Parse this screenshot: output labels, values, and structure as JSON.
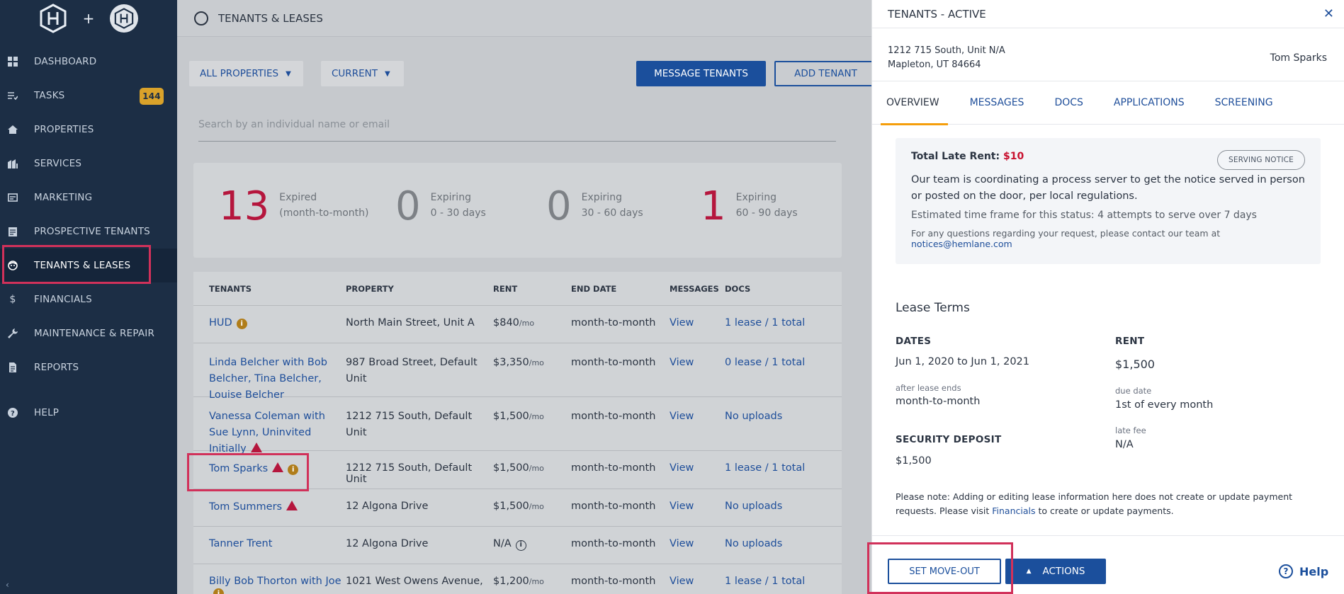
{
  "sidebar": {
    "logo_plus": "+",
    "items": [
      {
        "label": "DASHBOARD",
        "icon": "dashboard-icon"
      },
      {
        "label": "TASKS",
        "icon": "tasks-icon",
        "badge": "144"
      },
      {
        "label": "PROPERTIES",
        "icon": "home-icon"
      },
      {
        "label": "SERVICES",
        "icon": "services-icon"
      },
      {
        "label": "MARKETING",
        "icon": "marketing-icon"
      },
      {
        "label": "PROSPECTIVE TENANTS",
        "icon": "clipboard-icon"
      },
      {
        "label": "TENANTS & LEASES",
        "icon": "tenant-icon",
        "active": true
      },
      {
        "label": "FINANCIALS",
        "icon": "dollar-icon"
      },
      {
        "label": "MAINTENANCE & REPAIR",
        "icon": "wrench-icon"
      },
      {
        "label": "REPORTS",
        "icon": "report-icon"
      },
      {
        "label": "HELP",
        "icon": "help-icon"
      }
    ],
    "collapse_icon": "chevron-left-icon"
  },
  "main": {
    "title": "TENANTS & LEASES",
    "filters": {
      "properties": "ALL PROPERTIES",
      "status": "CURRENT"
    },
    "message_button": "MESSAGE TENANTS",
    "add_button": "ADD TENANT",
    "search_placeholder": "Search by an individual name or email",
    "stats": [
      {
        "num": "13",
        "line1": "Expired",
        "line2": "(month-to-month)"
      },
      {
        "num": "0",
        "line1": "Expiring",
        "line2": "0 - 30 days"
      },
      {
        "num": "0",
        "line1": "Expiring",
        "line2": "30 - 60 days"
      },
      {
        "num": "1",
        "line1": "Expiring",
        "line2": "60 - 90 days"
      }
    ],
    "table": {
      "headers": [
        "TENANTS",
        "PROPERTY",
        "RENT",
        "END DATE",
        "MESSAGES",
        "DOCS"
      ],
      "rows": [
        {
          "tenant": "HUD",
          "property": "North Main Street, Unit A",
          "rent": "$840",
          "per": "/mo",
          "end": "month-to-month",
          "messages": "View",
          "docs": "1 lease / 1 total"
        },
        {
          "tenant": "Linda Belcher with Bob Belcher, Tina Belcher, Louise Belcher",
          "property": "987 Broad Street, Default Unit",
          "rent": "$3,350",
          "per": "/mo",
          "end": "month-to-month",
          "messages": "View",
          "docs": "0 lease / 1 total"
        },
        {
          "tenant": "Vanessa Coleman with Sue Lynn, Uninvited Initially",
          "property": "1212 715 South, Default Unit",
          "rent": "$1,500",
          "per": "/mo",
          "end": "month-to-month",
          "messages": "View",
          "docs": "No uploads"
        },
        {
          "tenant": "Tom Sparks",
          "property": "1212 715 South, Default Unit",
          "rent": "$1,500",
          "per": "/mo",
          "end": "month-to-month",
          "messages": "View",
          "docs": "1 lease / 1 total"
        },
        {
          "tenant": "Tom Summers",
          "property": "12 Algona Drive",
          "rent": "$1,500",
          "per": "/mo",
          "end": "month-to-month",
          "messages": "View",
          "docs": "No uploads"
        },
        {
          "tenant": "Tanner Trent",
          "property": "12 Algona Drive",
          "rent": "N/A",
          "per": "",
          "end": "month-to-month",
          "messages": "View",
          "docs": "No uploads"
        },
        {
          "tenant": "Billy Bob Thorton with Joe",
          "property": "1021 West Owens Avenue,",
          "rent": "$1,200",
          "per": "/mo",
          "end": "month-to-month",
          "messages": "View",
          "docs": "1 lease / 1 total"
        }
      ]
    }
  },
  "panel": {
    "title": "TENANTS - ACTIVE",
    "address1": "1212 715 South, Unit N/A",
    "address2": "Mapleton, UT 84664",
    "tenant_name": "Tom Sparks",
    "tabs": [
      "OVERVIEW",
      "MESSAGES",
      "DOCS",
      "APPLICATIONS",
      "SCREENING"
    ],
    "notice": {
      "late_label": "Total Late Rent: ",
      "late_amount": "$10",
      "status_pill": "SERVING NOTICE",
      "text": "Our team is coordinating a process server to get the notice served in person or posted on the door, per local regulations.",
      "estimate": "Estimated time frame for this status: 4 attempts to serve over 7 days",
      "question": "For any questions regarding your request, please contact our team at ",
      "email": "notices@hemlane.com"
    },
    "lease": {
      "title": "Lease Terms",
      "dates_label": "DATES",
      "dates_value": "Jun 1, 2020 to Jun 1, 2021",
      "after_label": "after lease ends",
      "after_value": "month-to-month",
      "deposit_label": "SECURITY DEPOSIT",
      "deposit_value": "$1,500",
      "rent_label": "RENT",
      "rent_value": "$1,500",
      "due_label": "due date",
      "due_value": "1st of every month",
      "late_label": "late fee",
      "late_value": "N/A"
    },
    "note_pre": "Please note: Adding or editing lease information here does not create or update payment requests. Please visit ",
    "note_link": "Financials",
    "note_post": " to create or update payments.",
    "moveout_button": "SET MOVE-OUT",
    "actions_button": "ACTIONS",
    "help": "Help"
  }
}
